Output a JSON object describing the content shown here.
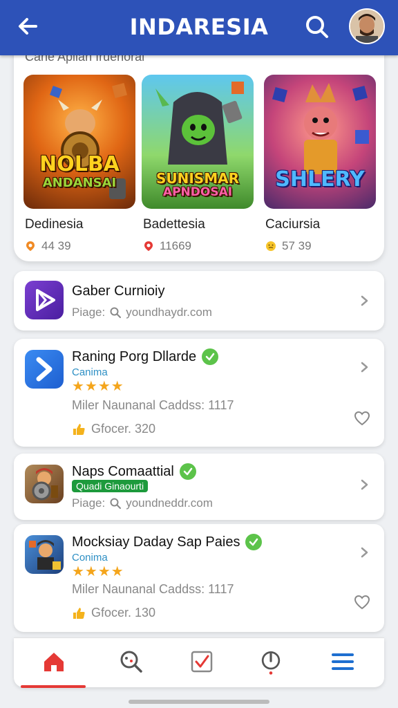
{
  "header": {
    "title": "INDARESIA"
  },
  "featured": {
    "heading": "Cane Aplian Iruenoral",
    "games": [
      {
        "art_line1": "NOLBA",
        "art_line2": "ANDANSAI",
        "name": "Dedinesia",
        "stat": "44 39",
        "stat_icon": "location-pin-icon"
      },
      {
        "art_line1": "SUNISMAR",
        "art_line2": "APNDOSAI",
        "name": "Badettesia",
        "stat": "11669",
        "stat_icon": "map-pin-icon"
      },
      {
        "art_line1": "SHLERY",
        "art_line2": "",
        "name": "Caciursia",
        "stat": "57 39",
        "stat_icon": "emoji-icon"
      }
    ]
  },
  "apps": [
    {
      "title": "Gaber Curnioiy",
      "sub_label": "Piage:",
      "sub_value": "youndhaydr.com"
    },
    {
      "title": "Raning Porg Dllarde",
      "category": "Canima",
      "stars": "★★★★",
      "desc": "Miler Naunanal Caddss: 1117",
      "likes": "Gfocer. 320"
    },
    {
      "title": "Naps Comaattial",
      "category": "Quadi Ginaourti",
      "sub_label": "Piage:",
      "sub_value": "youndneddr.com"
    },
    {
      "title": "Mocksiay Daday Sap Paies",
      "category": "Conima",
      "stars": "★★★★",
      "desc": "Miler Naunanal Caddss: 1117",
      "likes": "Gfocer. 130"
    }
  ],
  "colors": {
    "header": "#2d52b8",
    "accent_red": "#e53935",
    "verified_green": "#5cc34a",
    "star": "#f4a51c",
    "link_blue": "#2d8fc4",
    "nav_blue": "#1e6fd0"
  },
  "nav": {
    "items": [
      "home-icon",
      "search-explore-icon",
      "checklist-icon",
      "power-icon",
      "menu-icon"
    ],
    "active": "home-icon"
  }
}
